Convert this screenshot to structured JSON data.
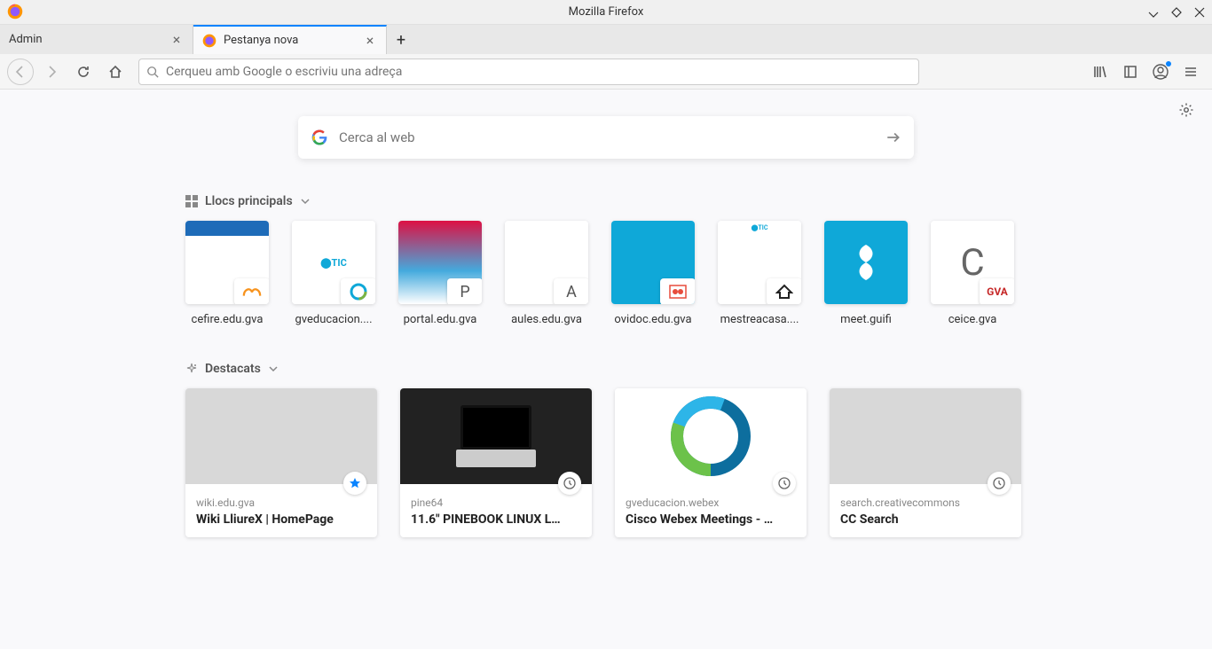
{
  "window": {
    "title": "Mozilla Firefox"
  },
  "tabs": [
    {
      "label": "Admin",
      "active": false
    },
    {
      "label": "Pestanya nova",
      "active": true
    }
  ],
  "urlbar": {
    "placeholder": "Cerqueu amb Google o escriviu una adreça"
  },
  "newtab": {
    "search_placeholder": "Cerca al web",
    "topsites_label": "Llocs principals",
    "highlights_label": "Destacats",
    "topsites": [
      {
        "label": "cefire.edu.gva",
        "badge": "",
        "badge_type": "icon",
        "thumb": "cefire"
      },
      {
        "label": "gveducacion....",
        "badge": "",
        "badge_type": "icon",
        "thumb": "gtic"
      },
      {
        "label": "portal.edu.gva",
        "badge": "P",
        "badge_type": "letter",
        "thumb": "portal"
      },
      {
        "label": "aules.edu.gva",
        "badge": "A",
        "badge_type": "letter",
        "thumb": "aules"
      },
      {
        "label": "ovidoc.edu.gva",
        "badge": "",
        "badge_type": "icon",
        "thumb": "ovidoc"
      },
      {
        "label": "mestreacasa....",
        "badge": "",
        "badge_type": "icon",
        "thumb": "mestre"
      },
      {
        "label": "meet.guifi",
        "badge": "",
        "badge_type": "none",
        "thumb": "guifi"
      },
      {
        "label": "ceice.gva",
        "badge": "GVA",
        "badge_type": "text",
        "letter": "C",
        "thumb": "ceice"
      }
    ],
    "highlights": [
      {
        "domain": "wiki.edu.gva",
        "title": "Wiki LliureX | HomePage",
        "badge": "star",
        "thumb": "gray"
      },
      {
        "domain": "pine64",
        "title": "11.6\" PINEBOOK LINUX L…",
        "badge": "clock",
        "thumb": "laptop"
      },
      {
        "domain": "gveducacion.webex",
        "title": "Cisco Webex Meetings - …",
        "badge": "clock",
        "thumb": "webex"
      },
      {
        "domain": "search.creativecommons",
        "title": "CC Search",
        "badge": "clock",
        "thumb": "gray"
      }
    ]
  }
}
